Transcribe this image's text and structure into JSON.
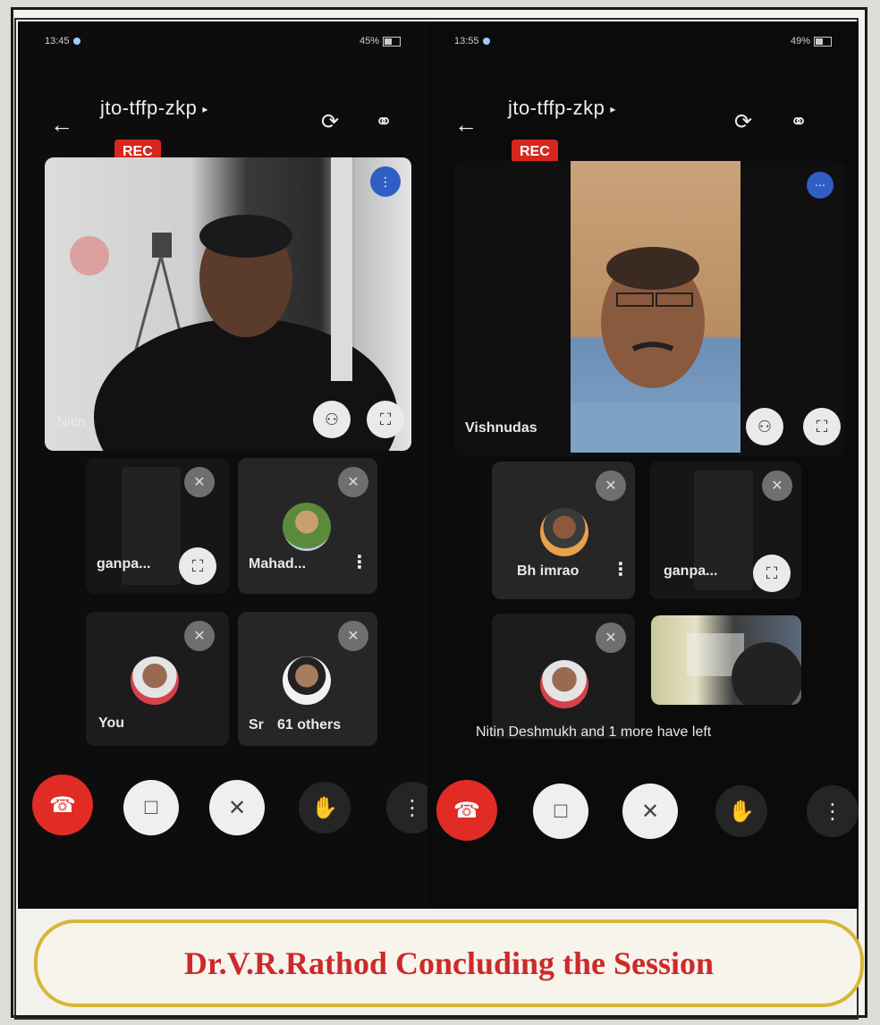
{
  "left": {
    "status": {
      "time": "13:45",
      "right": "45%"
    },
    "meeting_code": "jto-tffp-zkp",
    "rec_label": "REC",
    "featured_name": "Nitin",
    "tiles": [
      {
        "name": "ganpa..."
      },
      {
        "name": "Mahad..."
      },
      {
        "name": "You"
      },
      {
        "name": "Sr",
        "extra": "61 others"
      }
    ]
  },
  "right": {
    "status": {
      "time": "13:55",
      "right": "49%"
    },
    "meeting_code": "jto-tffp-zkp",
    "rec_label": "REC",
    "featured_name": "Vishnudas",
    "tiles": [
      {
        "name": "Bh imrao"
      },
      {
        "name": "ganpa..."
      }
    ],
    "left_notice": "Nitin Deshmukh and 1 more have left"
  },
  "caption": "Dr.V.R.Rathod Concluding the Session",
  "colors": {
    "rec": "#d7261d",
    "end_call": "#e12b25",
    "caption": "#cc2a2a",
    "caption_border": "#d7b637"
  }
}
